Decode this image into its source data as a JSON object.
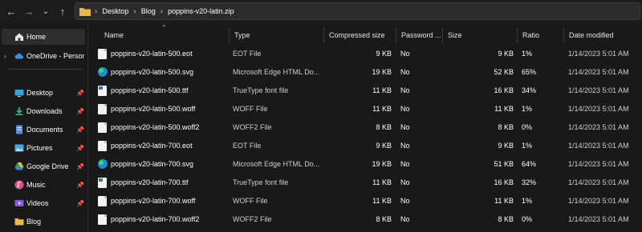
{
  "toolbar": {
    "breadcrumbs": [
      "Desktop",
      "Blog",
      "poppins-v20-latin.zip"
    ]
  },
  "sidebar": {
    "items": [
      {
        "label": "Home",
        "icon": "home-icon"
      },
      {
        "label": "OneDrive - Persona",
        "icon": "cloud-icon"
      },
      {
        "label": "Desktop",
        "icon": "desktop-icon"
      },
      {
        "label": "Downloads",
        "icon": "download-icon"
      },
      {
        "label": "Documents",
        "icon": "documents-icon"
      },
      {
        "label": "Pictures",
        "icon": "pictures-icon"
      },
      {
        "label": "Google Drive",
        "icon": "google-drive-icon"
      },
      {
        "label": "Music",
        "icon": "music-icon"
      },
      {
        "label": "Videos",
        "icon": "videos-icon"
      },
      {
        "label": "Blog",
        "icon": "folder-icon"
      }
    ]
  },
  "columns": {
    "name": "Name",
    "type": "Type",
    "compressed": "Compressed size",
    "password": "Password ...",
    "size": "Size",
    "ratio": "Ratio",
    "modified": "Date modified"
  },
  "files": [
    {
      "name": "poppins-v20-latin-500.eot",
      "type": "EOT File",
      "compressed": "9 KB",
      "password": "No",
      "size": "9 KB",
      "ratio": "1%",
      "modified": "1/14/2023 5:01 AM",
      "icon": "document-icon"
    },
    {
      "name": "poppins-v20-latin-500.svg",
      "type": "Microsoft Edge HTML Do...",
      "compressed": "19 KB",
      "password": "No",
      "size": "52 KB",
      "ratio": "65%",
      "modified": "1/14/2023 5:01 AM",
      "icon": "edge-icon"
    },
    {
      "name": "poppins-v20-latin-500.ttf",
      "type": "TrueType font file",
      "compressed": "11 KB",
      "password": "No",
      "size": "16 KB",
      "ratio": "34%",
      "modified": "1/14/2023 5:01 AM",
      "icon": "font-file-icon"
    },
    {
      "name": "poppins-v20-latin-500.woff",
      "type": "WOFF File",
      "compressed": "11 KB",
      "password": "No",
      "size": "11 KB",
      "ratio": "1%",
      "modified": "1/14/2023 5:01 AM",
      "icon": "document-icon"
    },
    {
      "name": "poppins-v20-latin-500.woff2",
      "type": "WOFF2 File",
      "compressed": "8 KB",
      "password": "No",
      "size": "8 KB",
      "ratio": "0%",
      "modified": "1/14/2023 5:01 AM",
      "icon": "document-icon"
    },
    {
      "name": "poppins-v20-latin-700.eot",
      "type": "EOT File",
      "compressed": "9 KB",
      "password": "No",
      "size": "9 KB",
      "ratio": "1%",
      "modified": "1/14/2023 5:01 AM",
      "icon": "document-icon"
    },
    {
      "name": "poppins-v20-latin-700.svg",
      "type": "Microsoft Edge HTML Do...",
      "compressed": "19 KB",
      "password": "No",
      "size": "51 KB",
      "ratio": "64%",
      "modified": "1/14/2023 5:01 AM",
      "icon": "edge-icon"
    },
    {
      "name": "poppins-v20-latin-700.ttf",
      "type": "TrueType font file",
      "compressed": "11 KB",
      "password": "No",
      "size": "16 KB",
      "ratio": "32%",
      "modified": "1/14/2023 5:01 AM",
      "icon": "font-file-icon"
    },
    {
      "name": "poppins-v20-latin-700.woff",
      "type": "WOFF File",
      "compressed": "11 KB",
      "password": "No",
      "size": "11 KB",
      "ratio": "1%",
      "modified": "1/14/2023 5:01 AM",
      "icon": "document-icon"
    },
    {
      "name": "poppins-v20-latin-700.woff2",
      "type": "WOFF2 File",
      "compressed": "8 KB",
      "password": "No",
      "size": "8 KB",
      "ratio": "0%",
      "modified": "1/14/2023 5:01 AM",
      "icon": "document-icon"
    }
  ],
  "colors": {
    "background": "#191919",
    "folder": "#e8b84a",
    "selected": "#2d2d2d"
  }
}
